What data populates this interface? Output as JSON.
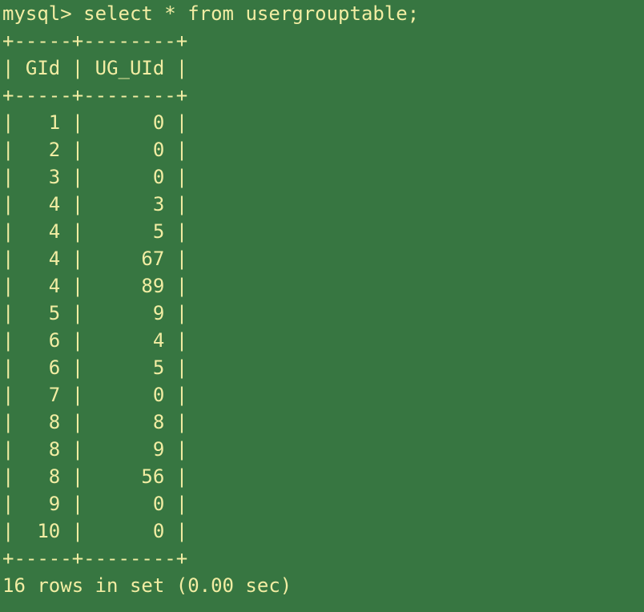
{
  "prompt": "mysql> ",
  "command": "select * from usergrouptable;",
  "table": {
    "border": "+-----+--------+",
    "headers": [
      "GId",
      "UG_UId"
    ],
    "rows": [
      [
        "1",
        "0"
      ],
      [
        "2",
        "0"
      ],
      [
        "3",
        "0"
      ],
      [
        "4",
        "3"
      ],
      [
        "4",
        "5"
      ],
      [
        "4",
        "67"
      ],
      [
        "4",
        "89"
      ],
      [
        "5",
        "9"
      ],
      [
        "6",
        "4"
      ],
      [
        "6",
        "5"
      ],
      [
        "7",
        "0"
      ],
      [
        "8",
        "8"
      ],
      [
        "8",
        "9"
      ],
      [
        "8",
        "56"
      ],
      [
        "9",
        "0"
      ],
      [
        "10",
        "0"
      ]
    ]
  },
  "result_summary": "16 rows in set (0.00 sec)",
  "colors": {
    "background": "#377641",
    "text": "#f2eda3"
  }
}
